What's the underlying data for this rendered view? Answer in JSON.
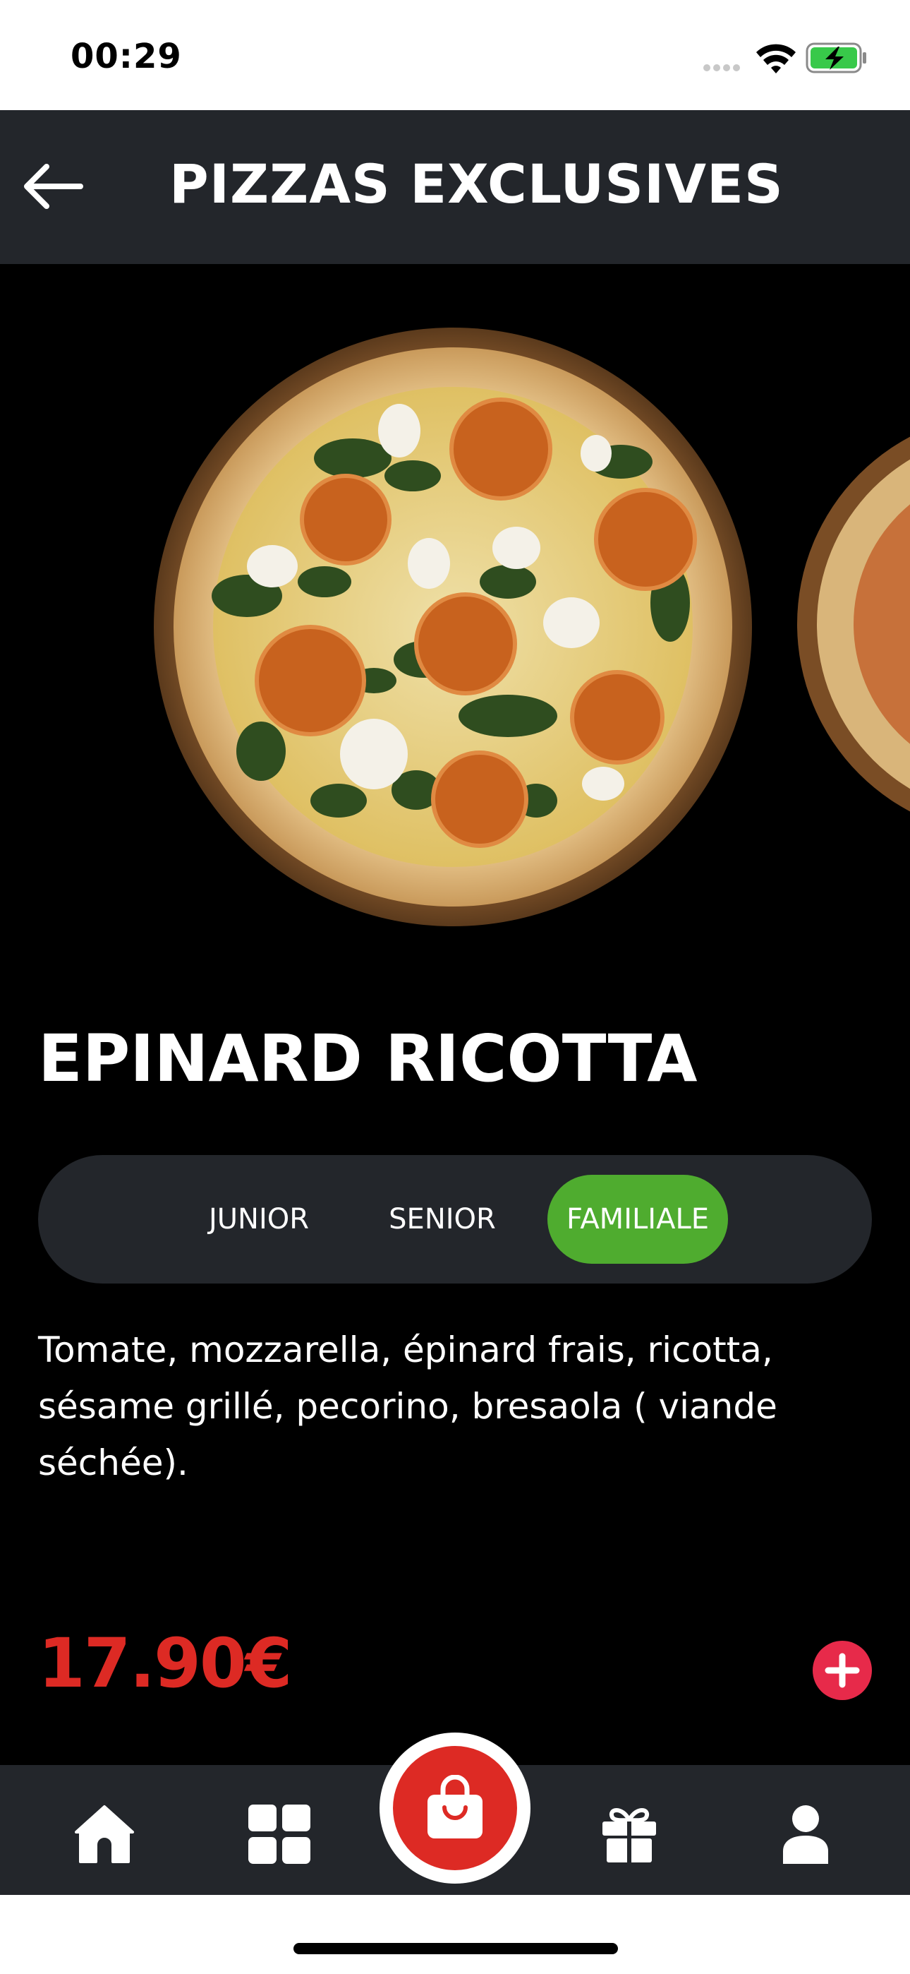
{
  "status_bar": {
    "time": "00:29",
    "icons": [
      "signal-icon",
      "wifi-icon",
      "battery-charging-icon"
    ],
    "battery_color": "#38c94a"
  },
  "header": {
    "back_icon": "arrow-left-icon",
    "title": "PIZZAS EXCLUSIVES"
  },
  "product": {
    "image_icon": "pizza-image",
    "name": "EPINARD RICOTTA",
    "sizes": [
      {
        "label": "JUNIOR",
        "selected": false
      },
      {
        "label": "SENIOR",
        "selected": false
      },
      {
        "label": "FAMILIALE",
        "selected": true
      }
    ],
    "description": "Tomate, mozzarella, épinard frais, ricotta, sésame grillé, pecorino, bresaola ( viande séchée).",
    "price": "17.90€",
    "add_icon": "plus-icon"
  },
  "bottom_nav": {
    "items": [
      "home-icon",
      "grid-icon",
      "shopping-bag-icon",
      "gift-icon",
      "user-icon"
    ],
    "active": "shopping-bag-icon"
  },
  "colors": {
    "header_bg": "#23262b",
    "accent_green": "#4fac2f",
    "price_red": "#dd2a24",
    "add_red": "#e72a4a",
    "page_bg": "#000000"
  }
}
